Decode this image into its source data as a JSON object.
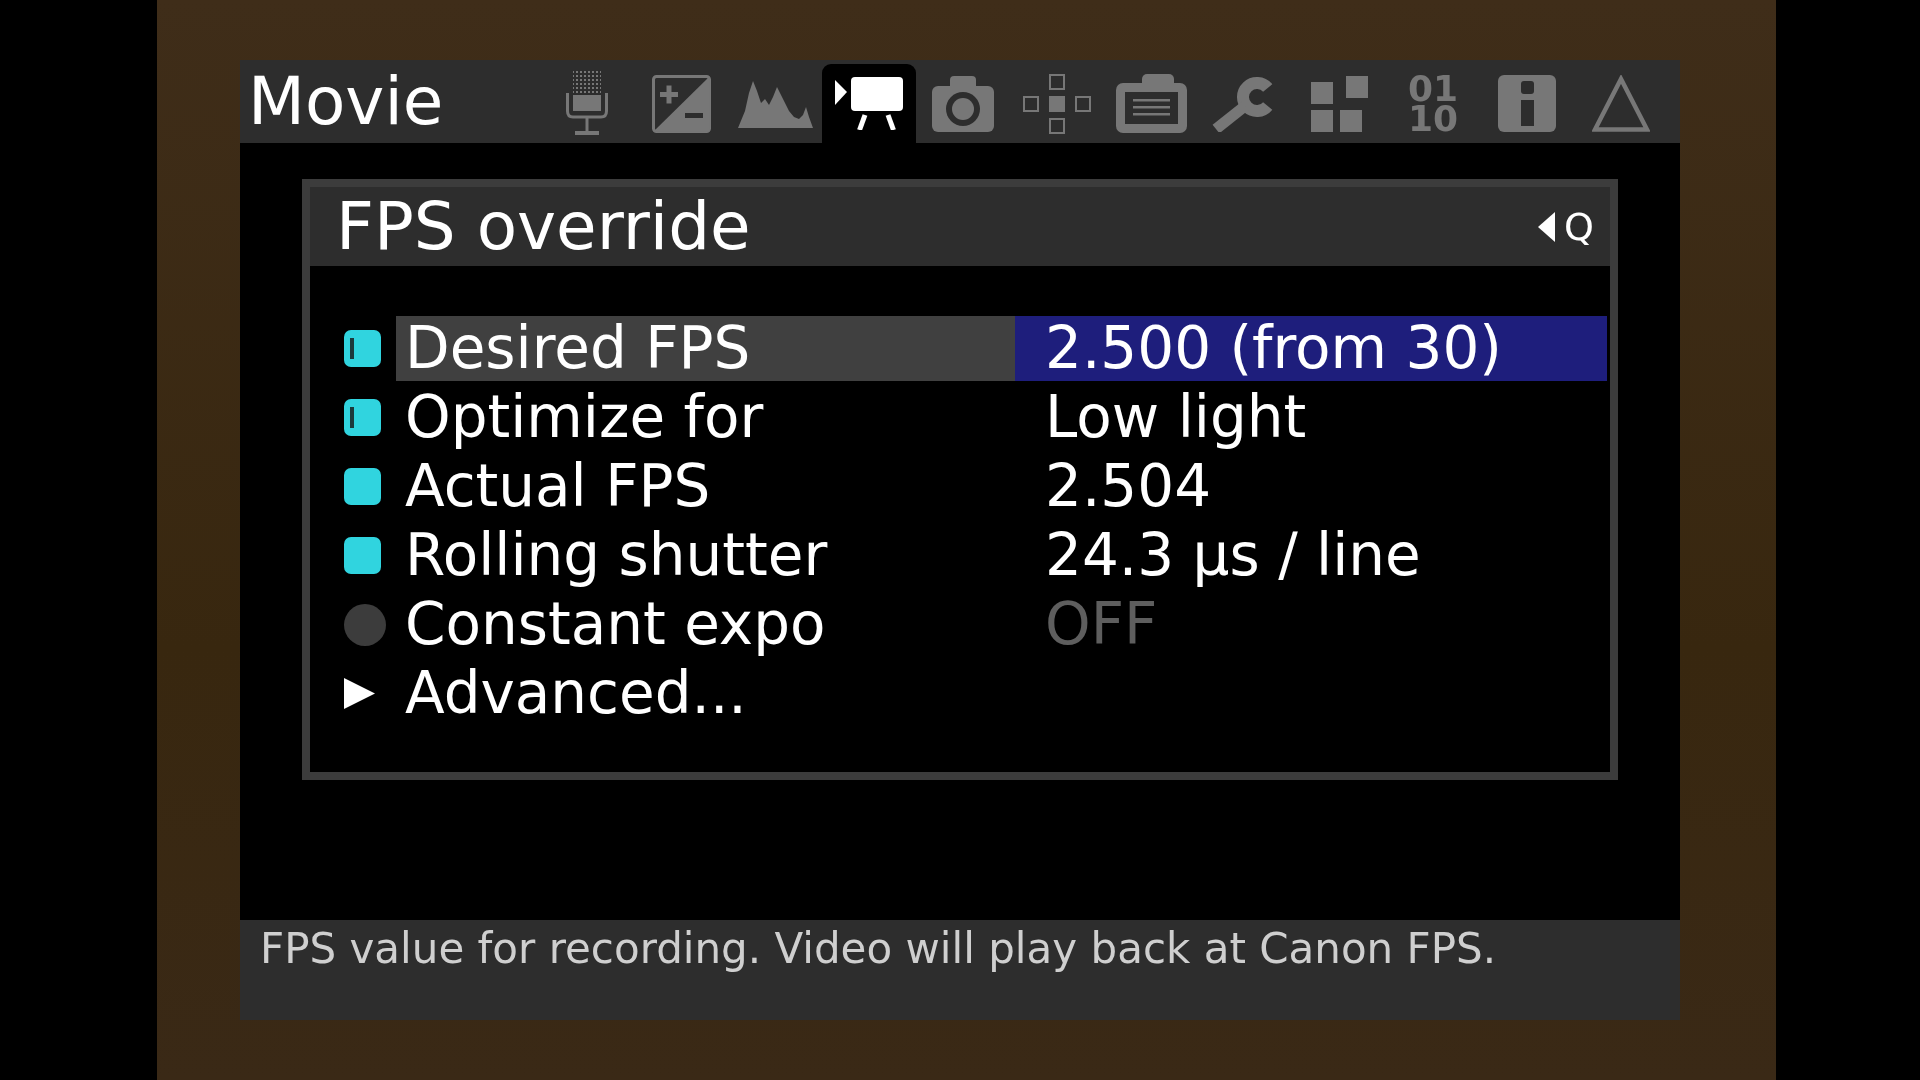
{
  "menu_title": "Movie",
  "tabs": [
    {
      "kind": "microphone",
      "selected": false
    },
    {
      "kind": "plusminus",
      "selected": false
    },
    {
      "kind": "histogram",
      "selected": false
    },
    {
      "kind": "moviecamera",
      "selected": true
    },
    {
      "kind": "camera",
      "selected": false
    },
    {
      "kind": "crosssquares",
      "selected": false
    },
    {
      "kind": "cameramenu",
      "selected": false
    },
    {
      "kind": "wrench",
      "selected": false
    },
    {
      "kind": "blocks",
      "selected": false
    },
    {
      "kind": "digits",
      "lines": [
        "01",
        "10"
      ],
      "selected": false
    },
    {
      "kind": "info",
      "selected": false
    },
    {
      "kind": "triangle",
      "selected": false
    }
  ],
  "submenu": {
    "title": "FPS override",
    "back_key": "Q",
    "items": [
      {
        "kind": "adjustable",
        "label": "Desired FPS",
        "value": "2.500 (from 30)",
        "selected": true
      },
      {
        "kind": "adjustable",
        "label": "Optimize for",
        "value": "Low light",
        "selected": false
      },
      {
        "kind": "readout",
        "label": "Actual FPS",
        "value": "2.504",
        "selected": false
      },
      {
        "kind": "readout",
        "label": "Rolling shutter",
        "value": "24.3 µs / line",
        "selected": false
      },
      {
        "kind": "toggle",
        "label": "Constant expo",
        "value": "OFF",
        "on": false,
        "selected": false
      },
      {
        "kind": "submenu",
        "label": "Advanced...",
        "selected": false
      }
    ]
  },
  "help_text": "FPS value for recording. Video will play back at Canon FPS."
}
